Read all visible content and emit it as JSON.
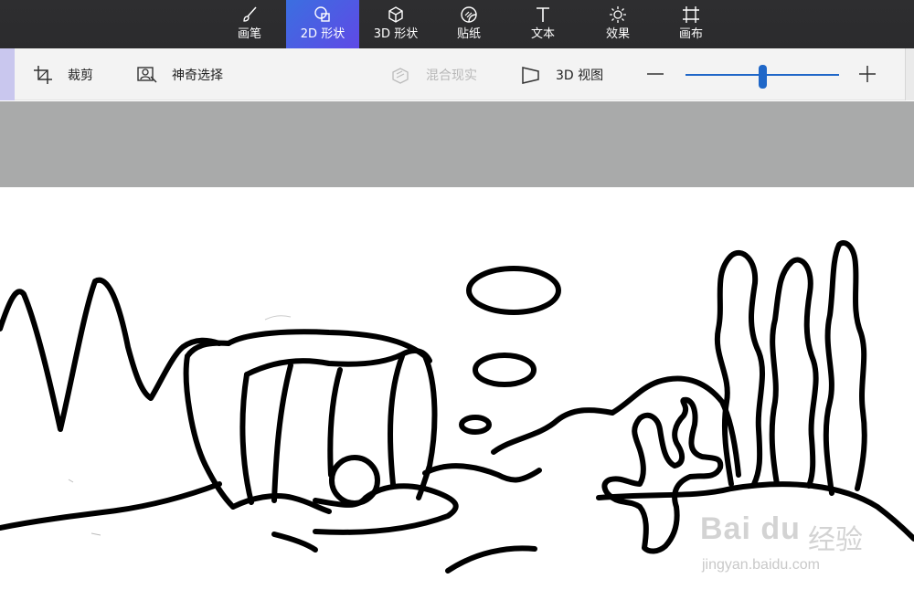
{
  "top_tabs": [
    {
      "label": "画笔",
      "icon": "brush-icon"
    },
    {
      "label": "2D 形状",
      "icon": "2d-shapes-icon",
      "active": true
    },
    {
      "label": "3D 形状",
      "icon": "3d-shapes-icon"
    },
    {
      "label": "贴纸",
      "icon": "sticker-icon"
    },
    {
      "label": "文本",
      "icon": "text-icon"
    },
    {
      "label": "效果",
      "icon": "effects-icon"
    },
    {
      "label": "画布",
      "icon": "canvas-icon"
    }
  ],
  "toolbar": {
    "crop_label": "裁剪",
    "magic_select_label": "神奇选择",
    "mixed_reality_label": "混合现实",
    "view_3d_label": "3D 视图",
    "zoom_minus": "—",
    "zoom_plus": "+",
    "zoom_level": 0.5
  },
  "watermark": {
    "brand": "Bai du",
    "brand_cn": "经验",
    "url": "jingyan.baidu.com"
  },
  "colors": {
    "accent": "#3b6fe0",
    "active_tab_end": "#5f49e6",
    "slider": "#1f67c8",
    "workspace": "#a9aaaa"
  }
}
